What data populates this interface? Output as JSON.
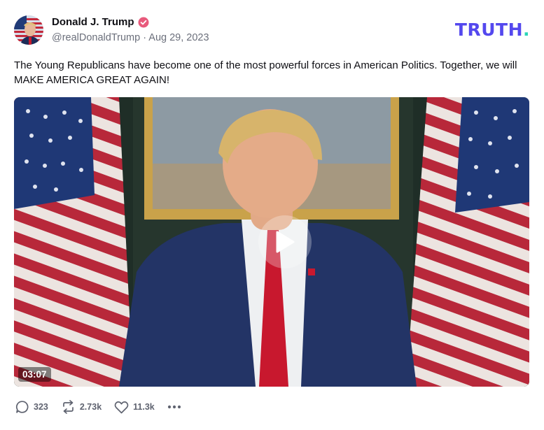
{
  "post": {
    "author_name": "Donald J. Trump",
    "handle_date": "@realDonaldTrump · Aug 29, 2023",
    "text": "The Young Republicans have become one of the most powerful forces in American Politics. Together, we will MAKE AMERICA GREAT AGAIN!"
  },
  "brand": {
    "logo_text": "TRUTH",
    "logo_dot": ".",
    "logo_color": "#5448ee",
    "dot_color": "#2ad5b7"
  },
  "video": {
    "duration": "03:07"
  },
  "actions": {
    "replies": "323",
    "retruths": "2.73k",
    "likes": "11.3k"
  },
  "icons": {
    "verified": "verified-badge-icon",
    "play": "play-icon",
    "reply": "reply-icon",
    "retruth": "retruth-icon",
    "like": "heart-icon",
    "more": "more-icon"
  },
  "colors": {
    "verified": "#e85a7c",
    "text": "#0f0f14",
    "muted": "#6b6f7b"
  }
}
